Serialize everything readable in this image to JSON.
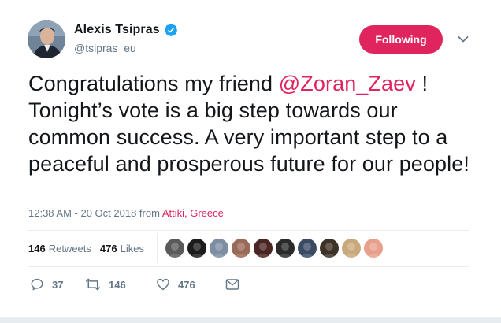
{
  "author": {
    "display_name": "Alexis Tsipras",
    "handle": "@tsipras_eu",
    "verified_icon": "verified-badge-icon"
  },
  "follow_button": {
    "label": "Following",
    "color": "#e0245e"
  },
  "tweet": {
    "text_before": "Congratulations my friend ",
    "mention": "@Zoran_Zaev",
    "text_after": " ! Tonight’s vote is a big step towards our common success. A very important step to a peaceful and prosperous future for our people!"
  },
  "meta": {
    "timestamp": "12:38 AM - 20 Oct 2018",
    "from_label": " from ",
    "location": "Attiki, Greece"
  },
  "stats": {
    "retweets_count": "146",
    "retweets_label": "Retweets",
    "likes_count": "476",
    "likes_label": "Likes"
  },
  "likers": [
    {
      "name": "liker-avatar-1",
      "color": "#5a5a5a"
    },
    {
      "name": "liker-avatar-2",
      "color": "#1c1c1c"
    },
    {
      "name": "liker-avatar-3",
      "color": "#7d8ea3"
    },
    {
      "name": "liker-avatar-4",
      "color": "#9a6a58"
    },
    {
      "name": "liker-avatar-5",
      "color": "#4b2524"
    },
    {
      "name": "liker-avatar-6",
      "color": "#2a2a2a"
    },
    {
      "name": "liker-avatar-7",
      "color": "#3b4a63"
    },
    {
      "name": "liker-avatar-8",
      "color": "#3d3226"
    },
    {
      "name": "liker-avatar-9",
      "color": "#c9a97c"
    },
    {
      "name": "liker-avatar-10",
      "color": "#e8a08c"
    }
  ],
  "actions": {
    "reply_count": "37",
    "retweet_count": "146",
    "like_count": "476"
  },
  "colors": {
    "accent": "#e0245e",
    "secondary_text": "#657786",
    "verified_blue": "#1da1f2"
  }
}
